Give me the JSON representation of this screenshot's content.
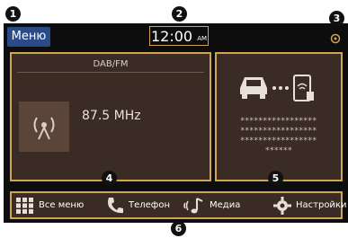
{
  "header": {
    "menu_label": "Меню",
    "clock_time": "12:00",
    "clock_period": "AM"
  },
  "radio_panel": {
    "band_label": "DAB/FM",
    "frequency": "87.5 MHz",
    "icon": "radio-antenna-icon"
  },
  "phone_panel": {
    "icons": [
      "car-icon",
      "dots-icon",
      "phone-connect-icon"
    ],
    "masked_lines": [
      "*****************",
      "*****************",
      "*****************",
      "******"
    ]
  },
  "bottom_nav": {
    "items": [
      {
        "label": "Все меню",
        "icon": "grid-icon"
      },
      {
        "label": "Телефон",
        "icon": "phone-icon"
      },
      {
        "label": "Медиа",
        "icon": "music-note-icon"
      },
      {
        "label": "Настройки",
        "icon": "gear-icon"
      }
    ]
  },
  "callouts": [
    "1",
    "2",
    "3",
    "4",
    "5",
    "6"
  ],
  "colors": {
    "accent": "#cfa553",
    "panel_bg": "#3a2b24",
    "screen_bg": "#0d0d0d",
    "menu_button": "#2b4a8a"
  }
}
